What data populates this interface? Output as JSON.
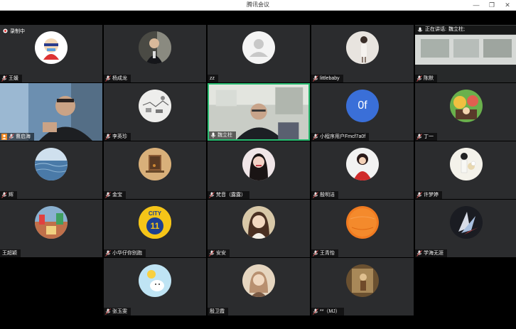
{
  "window": {
    "title": "腾讯会议",
    "min": "—",
    "max": "❐",
    "close": "✕"
  },
  "recording": {
    "label": "录制中"
  },
  "speaking": {
    "label": "正在讲话:",
    "name": "魏立柱;"
  },
  "participants": [
    {
      "id": "p1",
      "name": "王媛",
      "avatar": "cartoon"
    },
    {
      "id": "p2",
      "name": "杨成龙",
      "avatar": "suit"
    },
    {
      "id": "p3",
      "name": "zz",
      "avatar": "default"
    },
    {
      "id": "p4",
      "name": "littlebaby",
      "avatar": "girl-light"
    },
    {
      "id": "p5",
      "name": "陈默",
      "avatar": "video-room"
    },
    {
      "id": "p6",
      "name": "曹启海",
      "avatar": "video-man"
    },
    {
      "id": "p7",
      "name": "李英珍",
      "avatar": "sketch"
    },
    {
      "id": "p8",
      "name": "魏立柱",
      "avatar": "video-office"
    },
    {
      "id": "p9",
      "name": "小程序用户Fmcf7a0f",
      "avatar": "letters",
      "initials": "0f"
    },
    {
      "id": "p10",
      "name": "丁一",
      "avatar": "colorful"
    },
    {
      "id": "p11",
      "name": "辉",
      "avatar": "sea"
    },
    {
      "id": "p12",
      "name": "金宝",
      "avatar": "window"
    },
    {
      "id": "p13",
      "name": "梵音（露露）",
      "avatar": "woman-dark"
    },
    {
      "id": "p14",
      "name": "殷明洁",
      "avatar": "red-girl"
    },
    {
      "id": "p15",
      "name": "许梦婷",
      "avatar": "bouquet"
    },
    {
      "id": "p16",
      "name": "王超颖",
      "avatar": "street"
    },
    {
      "id": "p17",
      "name": "小华仔你别跑",
      "avatar": "yellow-ball",
      "badge_text": "CITY",
      "badge_num": "11"
    },
    {
      "id": "p18",
      "name": "安安",
      "avatar": "girl-face"
    },
    {
      "id": "p19",
      "name": "王青怡",
      "avatar": "orange"
    },
    {
      "id": "p20",
      "name": "学海无涯",
      "avatar": "bird"
    },
    {
      "id": "p21",
      "name": "张玉雯",
      "avatar": "cartoon-sun"
    },
    {
      "id": "p22",
      "name": "殷卫霞",
      "avatar": "vintage"
    },
    {
      "id": "p23",
      "name": "**（MJ）",
      "avatar": "painting"
    }
  ],
  "colors": {
    "tile": "#2b2c2e",
    "active_border": "#2bbd73",
    "letters_bg": "#3a6fd8",
    "mic_muted": "#e8e8e8",
    "mic_on": "#ffffff"
  }
}
